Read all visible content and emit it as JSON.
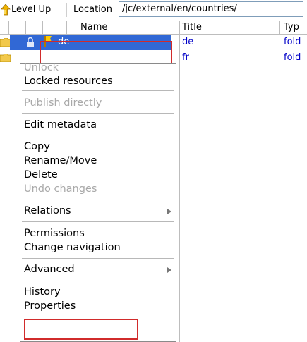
{
  "toolbar": {
    "level_up_label": "Level Up",
    "location_label": "Location",
    "location_value": "/jc/external/en/countries/"
  },
  "table": {
    "columns": [
      "Name",
      "Title",
      "Typ"
    ],
    "rows": [
      {
        "name": "de",
        "title": "de",
        "type": "fold",
        "selected": true
      },
      {
        "name": "",
        "title": "fr",
        "type": "fold",
        "selected": false
      }
    ]
  },
  "context_menu": {
    "unlock": "Unlock",
    "locked_resources": "Locked resources",
    "publish_directly": "Publish directly",
    "edit_metadata": "Edit metadata",
    "copy": "Copy",
    "rename_move": "Rename/Move",
    "delete": "Delete",
    "undo_changes": "Undo changes",
    "relations": "Relations",
    "permissions": "Permissions",
    "change_navigation": "Change navigation",
    "advanced": "Advanced",
    "history": "History",
    "properties": "Properties"
  },
  "colors": {
    "selection": "#3168d5",
    "highlight_box": "#d12b2b",
    "link_text": "#0000c8",
    "disabled_text": "#a9a9a9"
  }
}
